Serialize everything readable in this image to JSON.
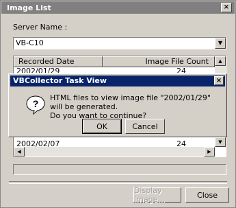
{
  "window": {
    "title": "Image List",
    "close_glyph": "×"
  },
  "server": {
    "label": "Server Name :",
    "value": "VB-C10",
    "arrow": "▼"
  },
  "table": {
    "columns": [
      "Recorded Date",
      "Image File Count"
    ],
    "rows": [
      {
        "date": "2002/01/29",
        "count": "24"
      },
      {
        "date": "2002/02/07",
        "count": "24"
      }
    ],
    "scroll_up": "▲",
    "scroll_down": "▼",
    "scroll_left": "◀",
    "scroll_right": "▶"
  },
  "buttons": {
    "display_image": "Display Image...",
    "close": "Close"
  },
  "dialog": {
    "title": "VBCollector Task View",
    "close_glyph": "×",
    "message_line1": "HTML files to view image file \"2002/01/29\" will be generated.",
    "message_line2": "Do you want to continue?",
    "ok": "OK",
    "cancel": "Cancel"
  }
}
